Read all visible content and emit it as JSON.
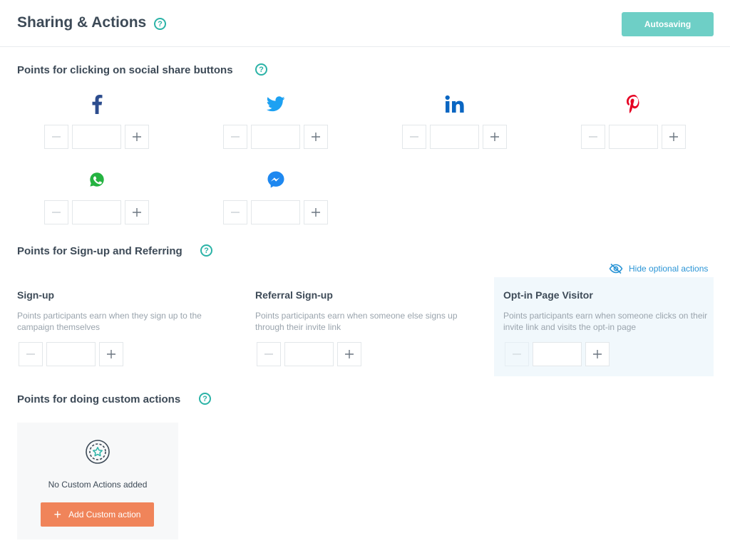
{
  "header": {
    "title": "Sharing & Actions",
    "autosave_label": "Autosaving"
  },
  "social_section": {
    "title": "Points for clicking on social share buttons",
    "networks": [
      {
        "name": "facebook",
        "icon": "facebook-icon",
        "color": "#2d4d8e",
        "value": ""
      },
      {
        "name": "twitter",
        "icon": "twitter-icon",
        "color": "#1da1f2",
        "value": ""
      },
      {
        "name": "linkedin",
        "icon": "linkedin-icon",
        "color": "#0a66c2",
        "value": ""
      },
      {
        "name": "pinterest",
        "icon": "pinterest-icon",
        "color": "#e60023",
        "value": ""
      },
      {
        "name": "whatsapp",
        "icon": "whatsapp-icon",
        "color": "#25b341",
        "value": ""
      },
      {
        "name": "messenger",
        "icon": "messenger-icon",
        "color": "#1e88f0",
        "value": ""
      }
    ]
  },
  "signup_section": {
    "title": "Points for Sign-up and Referring",
    "hide_link": "Hide optional actions",
    "options": [
      {
        "title": "Sign-up",
        "description": "Points participants earn when they sign up to the campaign themselves",
        "value": ""
      },
      {
        "title": "Referral Sign-up",
        "description": "Points participants earn when someone else signs up through their invite link",
        "value": ""
      },
      {
        "title": "Opt-in Page Visitor",
        "description": "Points participants earn when someone clicks on their invite link and visits the opt-in page",
        "value": ""
      }
    ]
  },
  "custom_section": {
    "title": "Points for doing custom actions",
    "empty_text": "No Custom Actions added",
    "add_label": "Add Custom action"
  },
  "colors": {
    "accent": "#2bb3a7",
    "autosave_bg": "#6ecfc6",
    "add_button": "#f0845a",
    "link": "#2b95d6",
    "highlight_panel": "#f1f8fc"
  }
}
